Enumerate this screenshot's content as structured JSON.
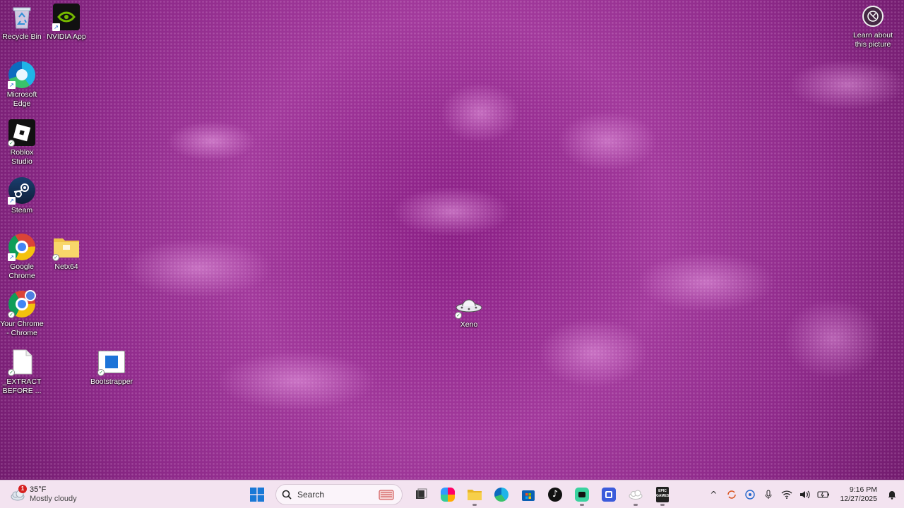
{
  "desktop": {
    "icons": [
      {
        "label": "Recycle Bin"
      },
      {
        "label": "NVIDIA App"
      },
      {
        "label": "Microsoft Edge"
      },
      {
        "label": "Roblox Studio"
      },
      {
        "label": "Steam"
      },
      {
        "label": "Google Chrome"
      },
      {
        "label": "Netx64"
      },
      {
        "label": "Your Chrome - Chrome"
      },
      {
        "label": "_EXTRACT BEFORE ..."
      },
      {
        "label": "Bootstrapper"
      },
      {
        "label": "Xeno"
      }
    ],
    "learn_about": "Learn about this picture"
  },
  "taskbar": {
    "weather": {
      "temp": "35°F",
      "condition": "Mostly cloudy",
      "alert_count": "1"
    },
    "search_placeholder": "Search",
    "apps": [
      "start-button",
      "search",
      "task-view",
      "copilot",
      "file-explorer",
      "edge",
      "microsoft-store",
      "tiktok",
      "app-green",
      "app-blue",
      "app-cloud",
      "epic-games"
    ],
    "clock": {
      "time": "9:16 PM",
      "date": "12/27/2025"
    }
  },
  "colors": {
    "wallpaper": "#9a3394",
    "taskbar": "#f3e3f0",
    "accent": "#0067c0"
  }
}
